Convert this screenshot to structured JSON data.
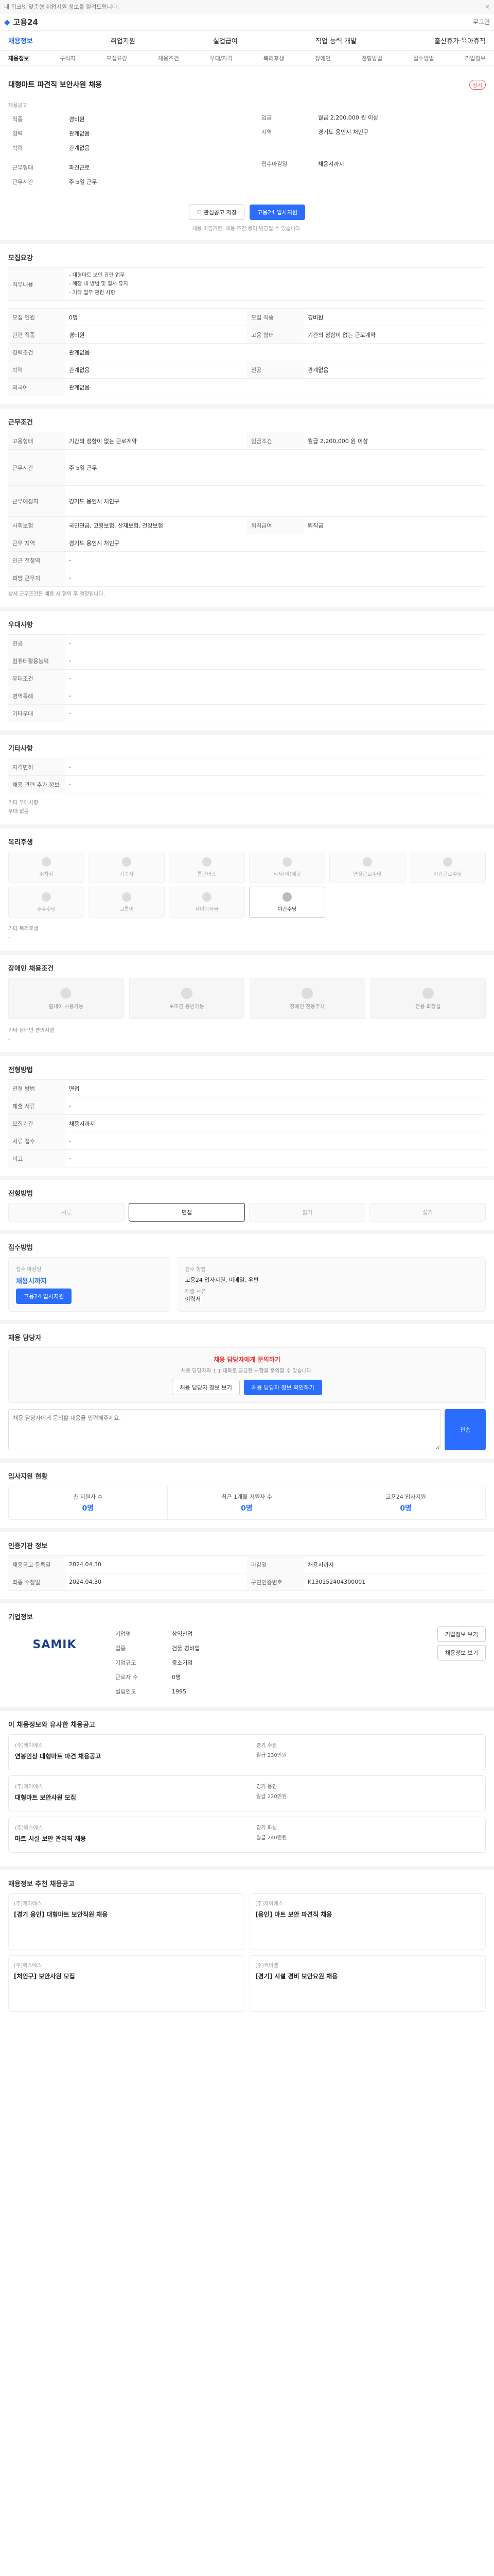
{
  "topbar": {
    "text": "내 워크넷 맞춤형 취업지원 정보를 알려드립니다.",
    "close": "×"
  },
  "header": {
    "logo": "고용24",
    "login": "로그인"
  },
  "nav": [
    "채용정보",
    "취업지원",
    "실업급여",
    "직업 능력 개발",
    "출산휴가·육아휴직"
  ],
  "subnav": [
    "채용정보",
    "구직자",
    "모집요강",
    "채용조건",
    "우대/자격",
    "복리후생",
    "장애인",
    "전형방법",
    "접수방법",
    "기업정보"
  ],
  "job": {
    "title": "대형마트 파견직 보안사원 채용",
    "badge": "채용공고",
    "status": "상시",
    "left": [
      {
        "k": "직종",
        "v": "경비원"
      },
      {
        "k": "경력",
        "v": "관계없음"
      },
      {
        "k": "학력",
        "v": "관계없음"
      }
    ],
    "right": [
      {
        "k": "임금",
        "v": "월급 2,200,000 원 이상"
      },
      {
        "k": "지역",
        "v": "경기도 용인시 처인구"
      }
    ],
    "left2": [
      {
        "k": "근무형태",
        "v": "파견근로"
      },
      {
        "k": "근무시간",
        "v": "주 5일 근무"
      }
    ],
    "right2": [
      {
        "k": "접수마감일",
        "v": "채용시까지"
      }
    ],
    "btn_save": "관심공고 저장",
    "btn_apply": "고용24 입사지원",
    "notice": "채용 마감기한, 채용 조건 등이 변경될 수 있습니다."
  },
  "recruit": {
    "title": "모집요강",
    "desc_k": "직무내용",
    "desc": [
      "- 대형마트 보안 관련 업무",
      "- 매장 내 방범 및 질서 유지",
      "- 기타 업무 관련 사항"
    ],
    "rows": [
      {
        "k": "모집 인원",
        "v": "0명",
        "k2": "모집 직종",
        "v2": "경비원"
      },
      {
        "k": "관련 직종",
        "v": "경비원",
        "k2": "고용 형태",
        "v2": "기간의 정함이 없는 근로계약"
      },
      {
        "k": "경력조건",
        "v": "관계없음",
        "k2": "",
        "v2": ""
      },
      {
        "k": "학력",
        "v": "관계없음",
        "k2": "전공",
        "v2": "관계없음"
      },
      {
        "k": "외국어",
        "v": "관계없음",
        "k2": "",
        "v2": ""
      }
    ]
  },
  "terms": {
    "title": "근무조건",
    "rows": [
      {
        "k": "고용형태",
        "v": "기간의 정함이 없는 근로계약",
        "k2": "임금조건",
        "v2": "월급 2,200,000 원 이상"
      },
      {
        "k": "근무시간",
        "v": "주 5일 근무",
        "k2": "",
        "v2": ""
      },
      {
        "k": "근무예정지",
        "v": "경기도 용인시 처인구",
        "k2": "",
        "v2": ""
      },
      {
        "k": "사회보험",
        "v": "국민연금, 고용보험, 산재보험, 건강보험",
        "k2": "퇴직급여",
        "v2": "퇴직금"
      },
      {
        "k": "근무 지역",
        "v": "경기도 용인시 처인구",
        "k2": "",
        "v2": ""
      },
      {
        "k": "인근 전철역",
        "v": "-",
        "k2": "",
        "v2": ""
      },
      {
        "k": "희망 근무지",
        "v": "-",
        "k2": "",
        "v2": ""
      }
    ],
    "footnote": "상세 근무조건은 채용 시 협의 후 결정됩니다."
  },
  "pref": {
    "title": "우대사항",
    "rows": [
      {
        "k": "전공",
        "v": "-"
      },
      {
        "k": "컴퓨터활용능력",
        "v": "-"
      },
      {
        "k": "우대조건",
        "v": "-"
      },
      {
        "k": "병역특례",
        "v": "-"
      },
      {
        "k": "기타우대",
        "v": "-"
      }
    ]
  },
  "cert": {
    "title": "기타사항",
    "rows": [
      {
        "k": "자격면허",
        "v": "-"
      },
      {
        "k": "채용 관련 추가 정보",
        "v": "-"
      }
    ],
    "note": "기타 우대사항",
    "note2": "우대 없음"
  },
  "benefit": {
    "title": "복리후생",
    "items": [
      "주차장",
      "기숙사",
      "통근버스",
      "식사(비)제공",
      "연장근로수당",
      "야간근로수당",
      "주휴수당",
      "교통비",
      "자녀학자금",
      "야간수당"
    ],
    "label": "기타 복리후생",
    "value": "-"
  },
  "disab": {
    "title": "장애인 채용조건",
    "items": [
      "휠체어 사용가능",
      "보조견 동반가능",
      "장애인 전용주차",
      "전용 화장실"
    ],
    "label": "기타 장애인 편의시설",
    "value": "-"
  },
  "select": {
    "title": "전형방법",
    "rows": [
      {
        "k": "전형 방법",
        "v": "면접"
      },
      {
        "k": "제출 서류",
        "v": "-"
      },
      {
        "k": "모집기간",
        "v": "채용시까지"
      },
      {
        "k": "서류 접수",
        "v": "-"
      },
      {
        "k": "비고",
        "v": "-"
      }
    ]
  },
  "process": {
    "title": "전형방법",
    "steps": [
      "서류",
      "면접",
      "필기",
      "실기"
    ]
  },
  "apply": {
    "title": "접수방법",
    "box_l_title": "접수 마감일",
    "box_l_val": "채용시까지",
    "btn": "고용24 입사지원",
    "box_r_title": "접수 방법",
    "box_r_val": "고용24 입사지원, 이메일, 우편",
    "doc": "제출 서류",
    "doc_v": "이력서"
  },
  "inquiry": {
    "title": "채용 담당자",
    "banner": "채용 담당자에게 문의하기",
    "desc": "채용 담당자와 1:1 대화로 궁금한 사항을 문의할 수 있습니다.",
    "btn1": "채용 담당자 정보 보기",
    "btn2": "채용 담당자 정보 확인하기",
    "placeholder": "채용 담당자에게 문의할 내용을 입력해주세요.",
    "send": "전송"
  },
  "stats": {
    "title": "입사지원 현황",
    "items": [
      {
        "k": "총 지원자 수",
        "v": "0명"
      },
      {
        "k": "최근 1개월 지원자 수",
        "v": "0명"
      },
      {
        "k": "고용24 입사지원",
        "v": "0명"
      }
    ]
  },
  "dates": {
    "title": "인증기관 정보",
    "rows": [
      {
        "k": "채용공고 등록일",
        "v": "2024.04.30",
        "k2": "마감일",
        "v2": "채용시까지"
      },
      {
        "k": "최종 수정일",
        "v": "2024.04.30",
        "k2": "구인인증번호",
        "v2": "K130152404300001"
      }
    ]
  },
  "company": {
    "title": "기업정보",
    "name": "SAMIK",
    "rows": [
      {
        "k": "기업명",
        "v": "삼익산업"
      },
      {
        "k": "업종",
        "v": "건물 경비업"
      },
      {
        "k": "기업규모",
        "v": "중소기업"
      },
      {
        "k": "근로자 수",
        "v": "0명"
      },
      {
        "k": "설립연도",
        "v": "1995"
      }
    ],
    "btn1": "기업정보 보기",
    "btn2": "채용정보 보기"
  },
  "similar": {
    "title": "이 채용정보와 유사한 채용공고",
    "items": [
      {
        "co": "(주)케이에스",
        "title": "연봉인상 대형마트 파견 채용공고",
        "loc": "경기 수원",
        "wage": "월급 230만원"
      },
      {
        "co": "(주)제이에스",
        "title": "대형마트 보안사원 모집",
        "loc": "경기 용인",
        "wage": "월급 220만원"
      },
      {
        "co": "(주)에스에스",
        "title": "마트 시설 보안 관리직 채용",
        "loc": "경기 화성",
        "wage": "월급 240만원"
      }
    ]
  },
  "recommend": {
    "title": "채용정보 추천 채용공고",
    "items": [
      {
        "co": "(주)케이에스",
        "title": "[경기 용인] 대형마트 보안직원 채용"
      },
      {
        "co": "(주)제이에스",
        "title": "[용인] 마트 보안 파견직 채용"
      },
      {
        "co": "(주)에스에스",
        "title": "[처인구] 보안사원 모집"
      },
      {
        "co": "(주)케이엘",
        "title": "[경기] 시설 경비 보안요원 채용"
      }
    ]
  }
}
